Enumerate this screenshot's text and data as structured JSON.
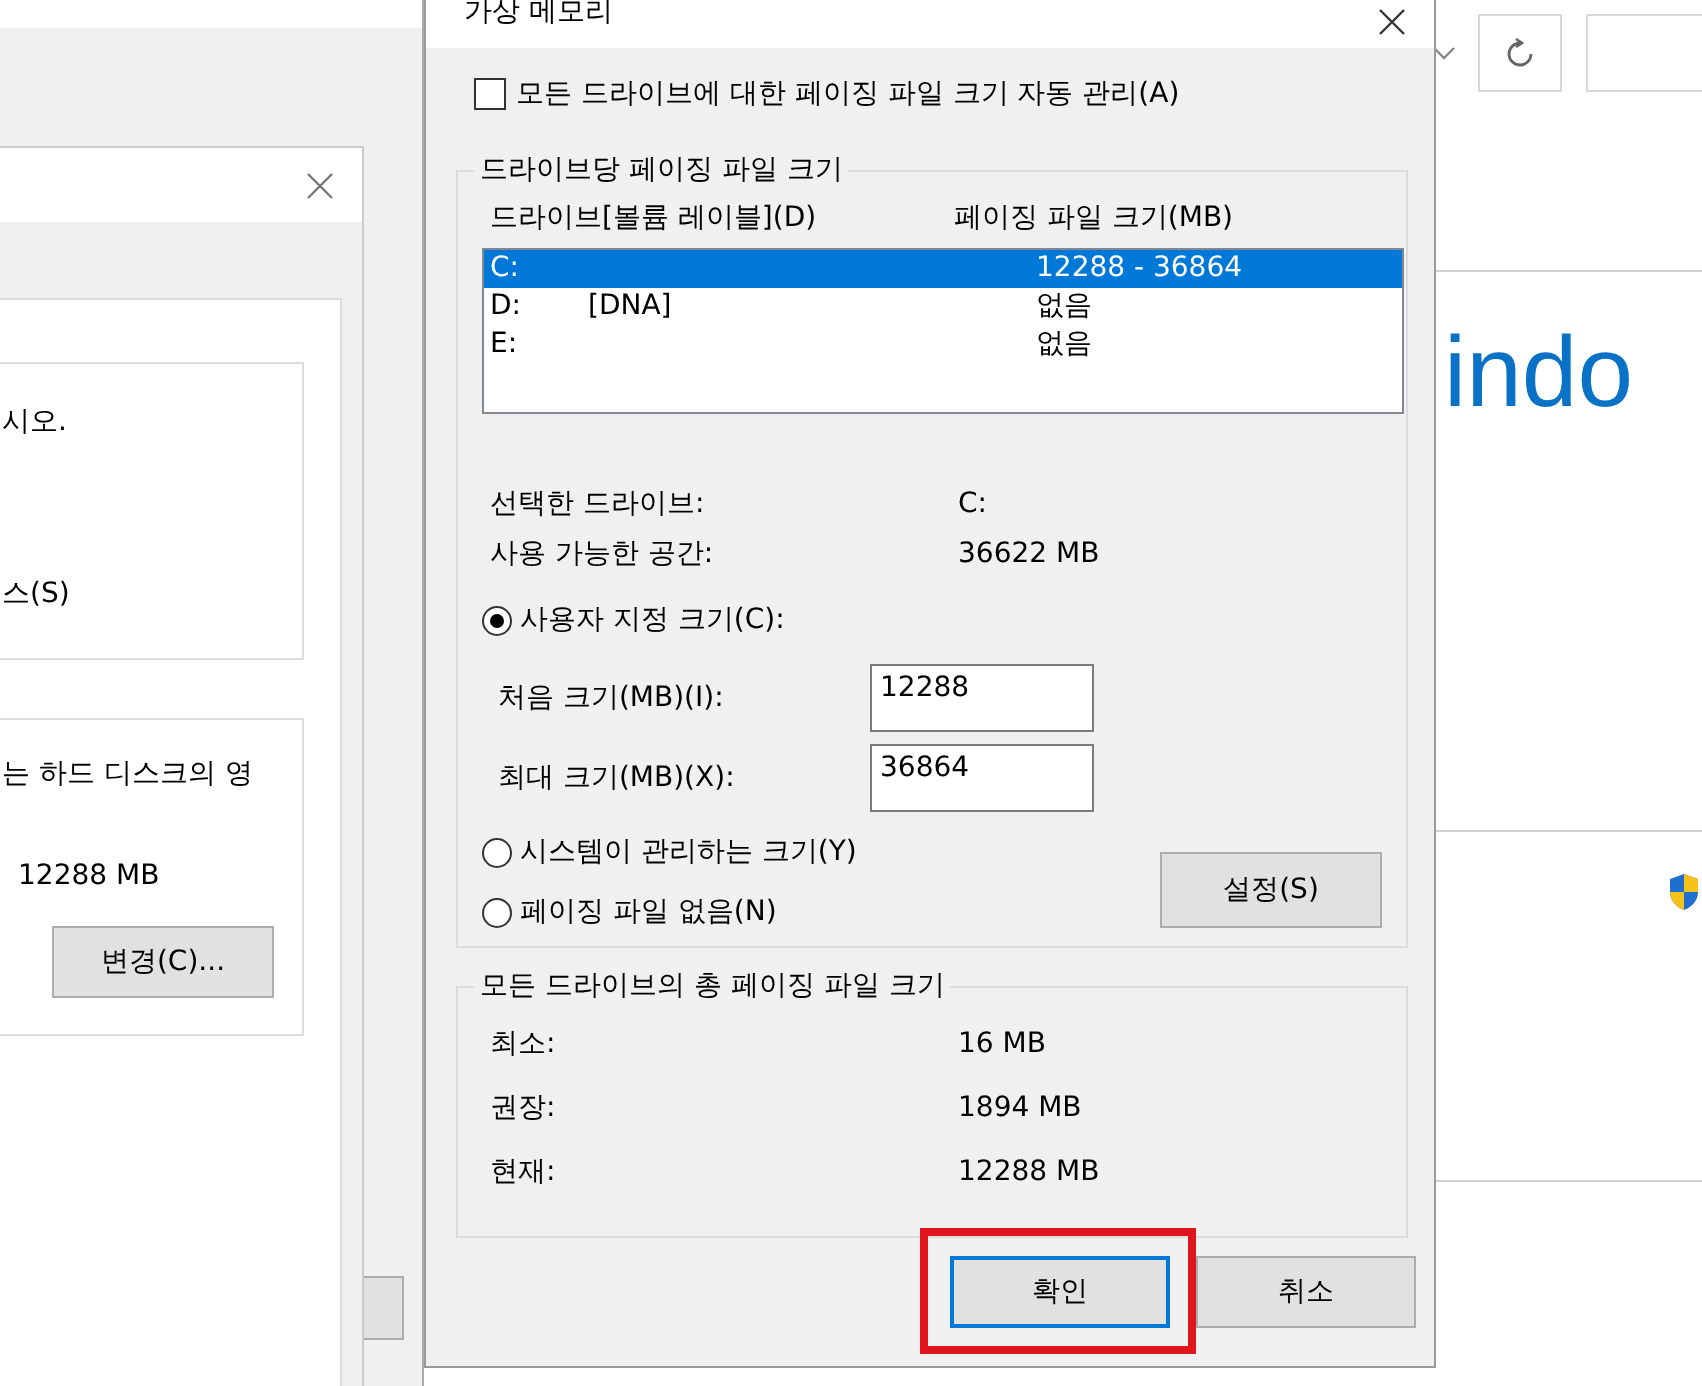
{
  "explorer": {
    "heading": "indo"
  },
  "performance_options": {
    "group_1": {
      "lines": [
        "시오.",
        "스(S)"
      ]
    },
    "group_2": {
      "line": "는 하드 디스크의 영",
      "value": "12288 MB",
      "button": "변경(C)..."
    }
  },
  "dialog": {
    "title": "가상 메모리",
    "auto_manage": {
      "label": "모든 드라이브에 대한 페이징 파일 크기 자동 관리(A)",
      "checked": false
    },
    "per_drive": {
      "title": "드라이브당 페이징 파일 크기",
      "columns": [
        "드라이브[볼륨 레이블](D)",
        "페이징 파일 크기(MB)"
      ],
      "drives": [
        {
          "drive": "C:",
          "size": "12288 - 36864",
          "selected": true
        },
        {
          "drive": "D:",
          "label": "[DNA]",
          "size": "없음",
          "selected": false
        },
        {
          "drive": "E:",
          "size": "없음",
          "selected": false
        }
      ],
      "info": [
        {
          "label": "선택한 드라이브:",
          "value": "C:"
        },
        {
          "label": "사용 가능한 공간:",
          "value": "36622 MB"
        }
      ],
      "size_options": [
        {
          "label": "사용자 지정 크기(C):",
          "selected": true
        },
        {
          "label": "시스템이 관리하는 크기(Y)",
          "selected": false
        },
        {
          "label": "페이징 파일 없음(N)",
          "selected": false
        }
      ],
      "fields": [
        {
          "label": "처음 크기(MB)(I):",
          "value": "12288"
        },
        {
          "label": "최대 크기(MB)(X):",
          "value": "36864"
        }
      ],
      "set_button": "설정(S)"
    },
    "totals": {
      "title": "모든 드라이브의 총 페이징 파일 크기",
      "rows": [
        {
          "label": "최소:",
          "value": "16 MB"
        },
        {
          "label": "권장:",
          "value": "1894 MB"
        },
        {
          "label": "현재:",
          "value": "12288 MB"
        }
      ]
    },
    "buttons": [
      {
        "label": "확인",
        "default": true,
        "highlighted": true
      },
      {
        "label": "취소",
        "default": false,
        "highlighted": false
      }
    ]
  }
}
